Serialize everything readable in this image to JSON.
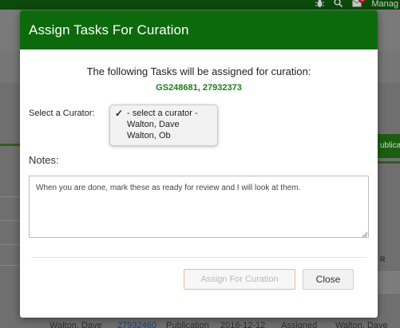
{
  "topbar": {
    "icons": [
      "bug-icon",
      "search-icon",
      "mail-icon"
    ],
    "notification_count": "1",
    "manage_label": "Manag"
  },
  "background": {
    "publish_button_label": "ublicat",
    "column_header_fragment": "R",
    "table_row": [
      "Walton, Dave",
      "27932460",
      "Publication",
      "2016-12-12",
      "Assigned",
      "Walton, Dave"
    ]
  },
  "modal": {
    "title": "Assign Tasks For Curation",
    "intro": "The following Tasks will be assigned for curation:",
    "task_ids": "GS248681, 27932373",
    "curator_label": "Select a Curator:",
    "curator_options": [
      "- select a curator -",
      "Walton, Dave",
      "Walton, Ob"
    ],
    "curator_selected": "- select a curator -",
    "notes_label": "Notes:",
    "notes_value": "When you are done, mark these as ready for review and I will look at them.",
    "assign_button": "Assign For Curation",
    "close_button": "Close"
  },
  "colors": {
    "header_green": "#0c6a0c",
    "task_id_green": "#1a7f1a",
    "assign_border": "#e5c08a"
  }
}
